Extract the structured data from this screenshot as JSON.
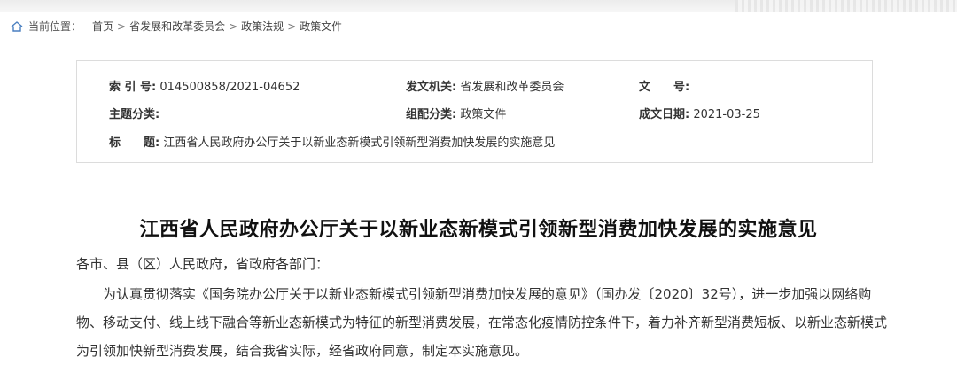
{
  "breadcrumb": {
    "label": "当前位置：",
    "items": [
      "首页",
      "省发展和改革委员会",
      "政策法规",
      "政策文件"
    ],
    "separator": ">"
  },
  "meta": {
    "index_label": "索 引 号:",
    "index_value": "014500858/2021-04652",
    "issuer_label": "发文机关:",
    "issuer_value": "省发展和改革委员会",
    "docno_label": "文　　号:",
    "docno_value": "",
    "topic_label": "主题分类:",
    "topic_value": "",
    "group_label": "组配分类:",
    "group_value": "政策文件",
    "date_label": "成文日期:",
    "date_value": "2021-03-25",
    "title_label": "标　　题:",
    "title_value": "江西省人民政府办公厅关于以新业态新模式引领新型消费加快发展的实施意见"
  },
  "document": {
    "title": "江西省人民政府办公厅关于以新业态新模式引领新型消费加快发展的实施意见",
    "salutation": "各市、县（区）人民政府，省政府各部门：",
    "paragraph1": "为认真贯彻落实《国务院办公厅关于以新业态新模式引领新型消费加快发展的意见》（国办发〔2020〕32号），进一步加强以网络购物、移动支付、线上线下融合等新业态新模式为特征的新型消费发展，在常态化疫情防控条件下，着力补齐新型消费短板、以新业态新模式为引领加快新型消费发展，结合我省实际，经省政府同意，制定本实施意见。"
  },
  "icons": {
    "home": "home-icon"
  }
}
